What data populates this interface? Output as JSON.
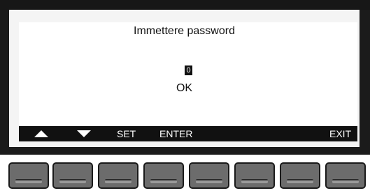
{
  "screen": {
    "title": "Immettere password",
    "password_digit": "0",
    "ok_label": "OK"
  },
  "softkeys": {
    "up": "up-arrow",
    "down": "down-arrow",
    "set": "SET",
    "enter": "ENTER",
    "exit": "EXIT"
  },
  "colors": {
    "bezel": "#1b1b1b",
    "screen_bg": "#ffffff",
    "softbar_bg": "#111111",
    "key_fill": "#6c6c6c"
  }
}
